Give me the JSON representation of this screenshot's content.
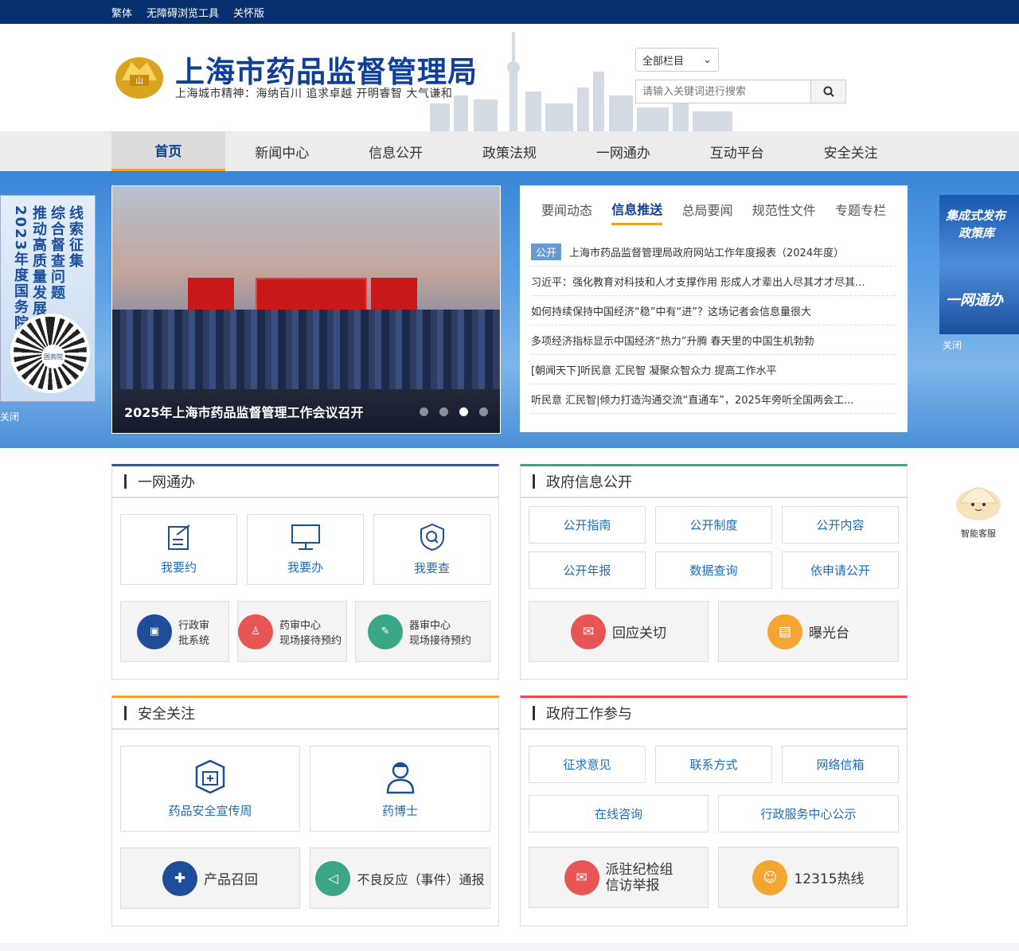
{
  "topbar": {
    "links": [
      "繁体",
      "无障碍浏览工具",
      "关怀版"
    ]
  },
  "header": {
    "title": "上海市药品监督管理局",
    "motto": "上海城市精神：海纳百川  追求卓越  开明睿智  大气谦和",
    "search_scope": "全部栏目",
    "search_placeholder": "请输入关键词进行搜索"
  },
  "nav": {
    "items": [
      "首页",
      "新闻中心",
      "信息公开",
      "政策法规",
      "一网通办",
      "互动平台",
      "安全关注"
    ],
    "active": 0
  },
  "banner": {
    "slide_caption": "2025年上海市药品监督管理工作会议召开",
    "slide_count": 4,
    "slide_active": 2,
    "tabs": [
      "要闻动态",
      "信息推送",
      "总局要闻",
      "规范性文件",
      "专题专栏"
    ],
    "active_tab": 1,
    "news_tag": "公开",
    "news": [
      "上海市药品监督管理局政府网站工作年度报表（2024年度）",
      "习近平：强化教育对科技和人才支撑作用 形成人才辈出人尽其才才尽其...",
      "如何持续保持中国经济“稳”中有“进”？这场记者会信息量很大",
      "多项经济指标显示中国经济“热力”升腾 春天里的中国生机勃勃",
      "[朝闻天下]听民意 汇民智 凝聚众智众力 提高工作水平",
      "听民意 汇民智|倾力打造沟通交流“直通车”，2025年旁听全国两会工..."
    ],
    "left_ad": {
      "lines": [
        "线索征集",
        "综合督查问题",
        "推动高质量发展",
        "2023年度国务院"
      ],
      "qr_label": "国务院",
      "close": "关闭"
    },
    "right_ad": {
      "line1": "集成式发布",
      "line2": "政策库",
      "line3": "一网通办",
      "close": "关闭"
    }
  },
  "panels": {
    "one_net": {
      "title": "一网通办",
      "cards": [
        "我要约",
        "我要办",
        "我要查"
      ],
      "services": [
        {
          "l1": "行政审",
          "l2": "批系统"
        },
        {
          "l1": "药审中心",
          "l2": "现场接待预约"
        },
        {
          "l1": "器审中心",
          "l2": "现场接待预约"
        }
      ]
    },
    "gov_info": {
      "title": "政府信息公开",
      "cards": [
        "公开指南",
        "公开制度",
        "公开内容",
        "公开年报",
        "数据查询",
        "依申请公开"
      ],
      "big": [
        "回应关切",
        "曝光台"
      ]
    },
    "safety": {
      "title": "安全关注",
      "cards": [
        "药品安全宣传周",
        "药博士"
      ],
      "big": [
        "产品召回",
        "不良反应（事件）通报"
      ]
    },
    "participation": {
      "title": "政府工作参与",
      "cards": [
        "征求意见",
        "联系方式",
        "网络信箱"
      ],
      "cards2": [
        "在线咨询",
        "行政服务中心公示"
      ],
      "big": [
        "派驻纪检组\n信访举报",
        "12315热线"
      ]
    }
  },
  "bot": {
    "label": "智能客服"
  },
  "colors": {
    "brand": "#0f3f97",
    "topbar": "#06306f",
    "accent": "#f0a030"
  }
}
